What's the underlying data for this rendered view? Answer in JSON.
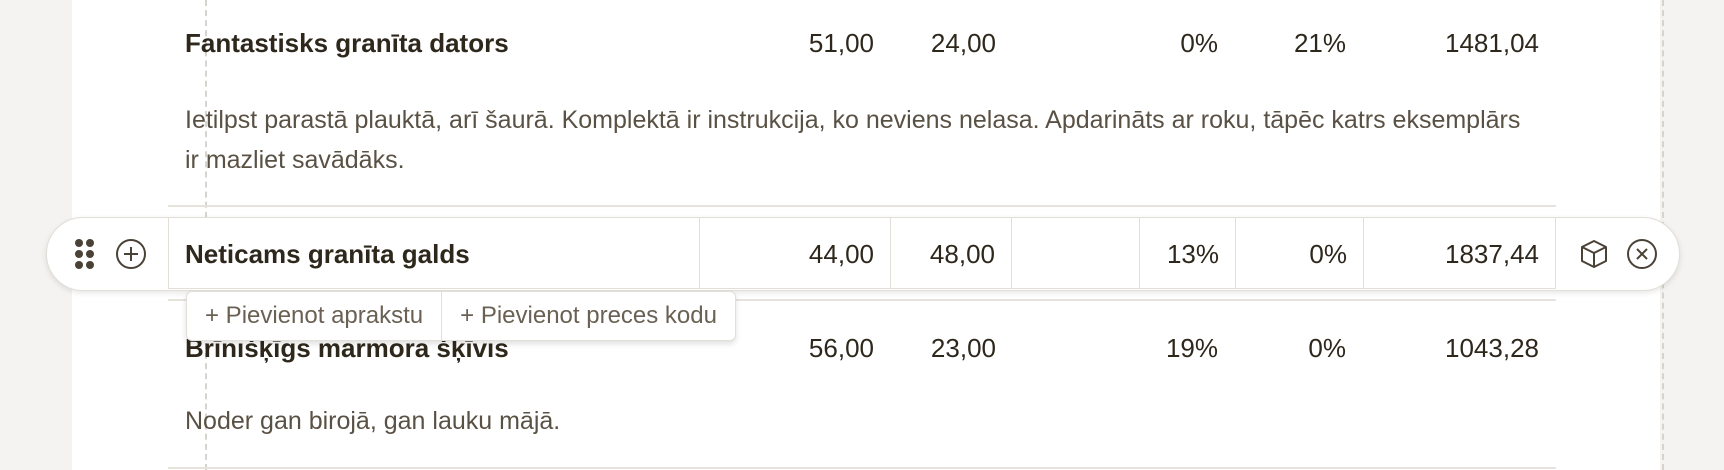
{
  "items": [
    {
      "name": "Fantastisks granīta dators",
      "quantity": "51,00",
      "price": "24,00",
      "discount": "",
      "vat_a": "0%",
      "vat_b": "21%",
      "total": "1481,04",
      "description": "Ietilpst parastā plauktā, arī šaurā. Komplektā ir instrukcija, ko neviens nelasa. Apdarināts ar roku, tāpēc katrs eksemplārs ir mazliet savādāks."
    },
    {
      "name": "Neticams granīta galds",
      "quantity": "44,00",
      "price": "48,00",
      "discount": "",
      "vat_a": "13%",
      "vat_b": "0%",
      "total": "1837,44",
      "description": ""
    },
    {
      "name": "Brīnišķīgs marmora šķīvis",
      "quantity": "56,00",
      "price": "23,00",
      "discount": "",
      "vat_a": "19%",
      "vat_b": "0%",
      "total": "1043,28",
      "description": "Noder gan birojā, gan lauku mājā."
    }
  ],
  "actions": {
    "add_description": "+ Pievienot aprakstu",
    "add_product_code": "+ Pievienot preces kodu"
  },
  "icons": {
    "drag": "drag-handle-icon",
    "add": "plus-circle-icon",
    "product": "cube-icon",
    "remove": "close-circle-icon"
  }
}
